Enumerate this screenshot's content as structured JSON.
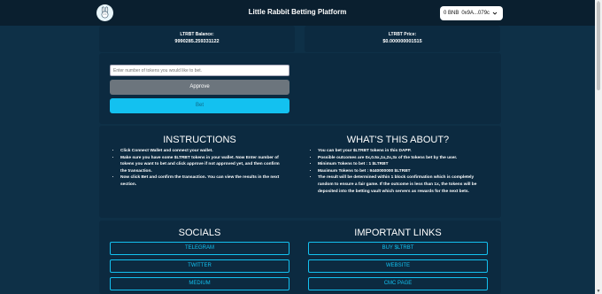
{
  "nav": {
    "title": "Little Rabbit Betting Platform",
    "wallet_balance": "0 BNB",
    "wallet_address": "0x9A...079c"
  },
  "stats": {
    "balance_label": "LTRBT Balance:",
    "balance_value": "9990285.259331122",
    "price_label": "LTRBT Price:",
    "price_value": "$0.000000001515"
  },
  "bet": {
    "placeholder": "Enter number of tokens you would like to bet.",
    "approve_label": "Approve",
    "bet_label": "Bet"
  },
  "instructions": {
    "title": "INSTRUCTIONS",
    "items": [
      "Click Connect Wallet and connect your wallet.",
      "Make sure you have some $LTRBT tokens in your wallet. Now Enter number of tokens you want to bet and click approve if not approved yet, and then confirm the transaction.",
      "Now click Bet and confirm the transaction. You can view the results in the next section."
    ]
  },
  "about": {
    "title": "WHAT'S THIS ABOUT?",
    "items": [
      "You can bet your $LTRBT tokens in this DAPP.",
      "Possible outcomes are 0x,0.5x,1x,2x,3x of the tokens bet by the user.",
      "Minimum Tokens to bet : 1 $LTRBT",
      "Maximum Tokens to bet : 9440000000 $LTRBT",
      "The result will be determined within 1 block confirmation which is completely random to ensure a fair game. If the outcome is less than 1x, the tokens will be deposited into the betting vault which servers as rewards for the next bets."
    ]
  },
  "socials": {
    "title": "SOCIALS",
    "links": [
      "TELEGRAM",
      "TWITTER",
      "MEDIUM"
    ]
  },
  "important": {
    "title": "IMPORTANT LINKS",
    "links": [
      "BUY $LTRBT",
      "WEBSITE",
      "CMC PAGE"
    ]
  },
  "colors": {
    "background": "#0e3047",
    "panel": "#0c2a40",
    "accent": "#13c1f0",
    "approve": "#6c757d"
  }
}
